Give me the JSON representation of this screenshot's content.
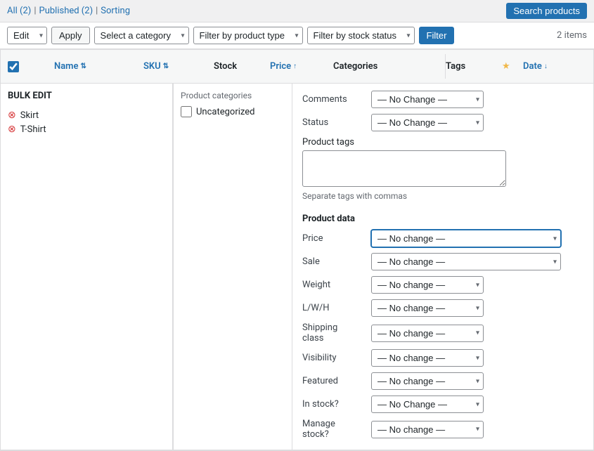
{
  "topbar": {
    "all_label": "All (2)",
    "published_label": "Published (2)",
    "sorting_label": "Sorting",
    "search_btn": "Search products"
  },
  "toolbar": {
    "edit_option": "Edit",
    "apply_label": "Apply",
    "select_category_placeholder": "Select a category",
    "filter_product_type": "Filter by product type",
    "filter_stock_status": "Filter by stock status",
    "filter_btn": "Filter",
    "items_count": "2 items"
  },
  "table": {
    "columns": [
      "Name",
      "SKU",
      "Stock",
      "Price",
      "Categories",
      "Tags",
      "★",
      "Date"
    ]
  },
  "bulk_edit": {
    "title": "BULK EDIT",
    "products": [
      "Skirt",
      "T-Shirt"
    ],
    "product_categories_label": "Product categories",
    "categories": [
      "Uncategorized"
    ],
    "comments_label": "Comments",
    "status_label": "Status",
    "product_tags_label": "Product tags",
    "tags_hint": "Separate tags with commas",
    "product_data_label": "Product data",
    "price_label": "Price",
    "sale_label": "Sale",
    "weight_label": "Weight",
    "lwh_label": "L/W/H",
    "shipping_label": "Shipping",
    "shipping_sub": "class",
    "visibility_label": "Visibility",
    "featured_label": "Featured",
    "in_stock_label": "In stock?",
    "manage_label": "Manage",
    "manage_sub": "stock?",
    "no_change_caps": "— No Change —",
    "no_change": "— No change —"
  }
}
